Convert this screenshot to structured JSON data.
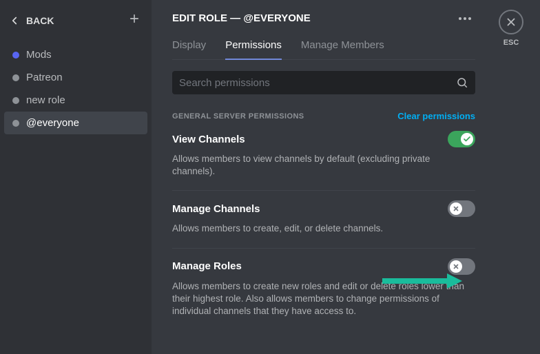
{
  "sidebar": {
    "back_label": "BACK",
    "roles": [
      {
        "name": "Mods",
        "color": "#5865f2",
        "selected": false
      },
      {
        "name": "Patreon",
        "color": "#8e9297",
        "selected": false
      },
      {
        "name": "new role",
        "color": "#8e9297",
        "selected": false
      },
      {
        "name": "@everyone",
        "color": "#8e9297",
        "selected": true
      }
    ]
  },
  "header": {
    "title": "EDIT ROLE — @EVERYONE"
  },
  "tabs": [
    {
      "label": "Display",
      "active": false
    },
    {
      "label": "Permissions",
      "active": true
    },
    {
      "label": "Manage Members",
      "active": false
    }
  ],
  "search": {
    "placeholder": "Search permissions"
  },
  "section": {
    "label": "GENERAL SERVER PERMISSIONS",
    "clear": "Clear permissions"
  },
  "permissions": [
    {
      "title": "View Channels",
      "desc": "Allows members to view channels by default (excluding private channels).",
      "on": true
    },
    {
      "title": "Manage Channels",
      "desc": "Allows members to create, edit, or delete channels.",
      "on": false
    },
    {
      "title": "Manage Roles",
      "desc": "Allows members to create new roles and edit or delete roles lower than their highest role. Also allows members to change permissions of individual channels that they have access to.",
      "on": false
    }
  ],
  "close": {
    "esc": "ESC"
  }
}
